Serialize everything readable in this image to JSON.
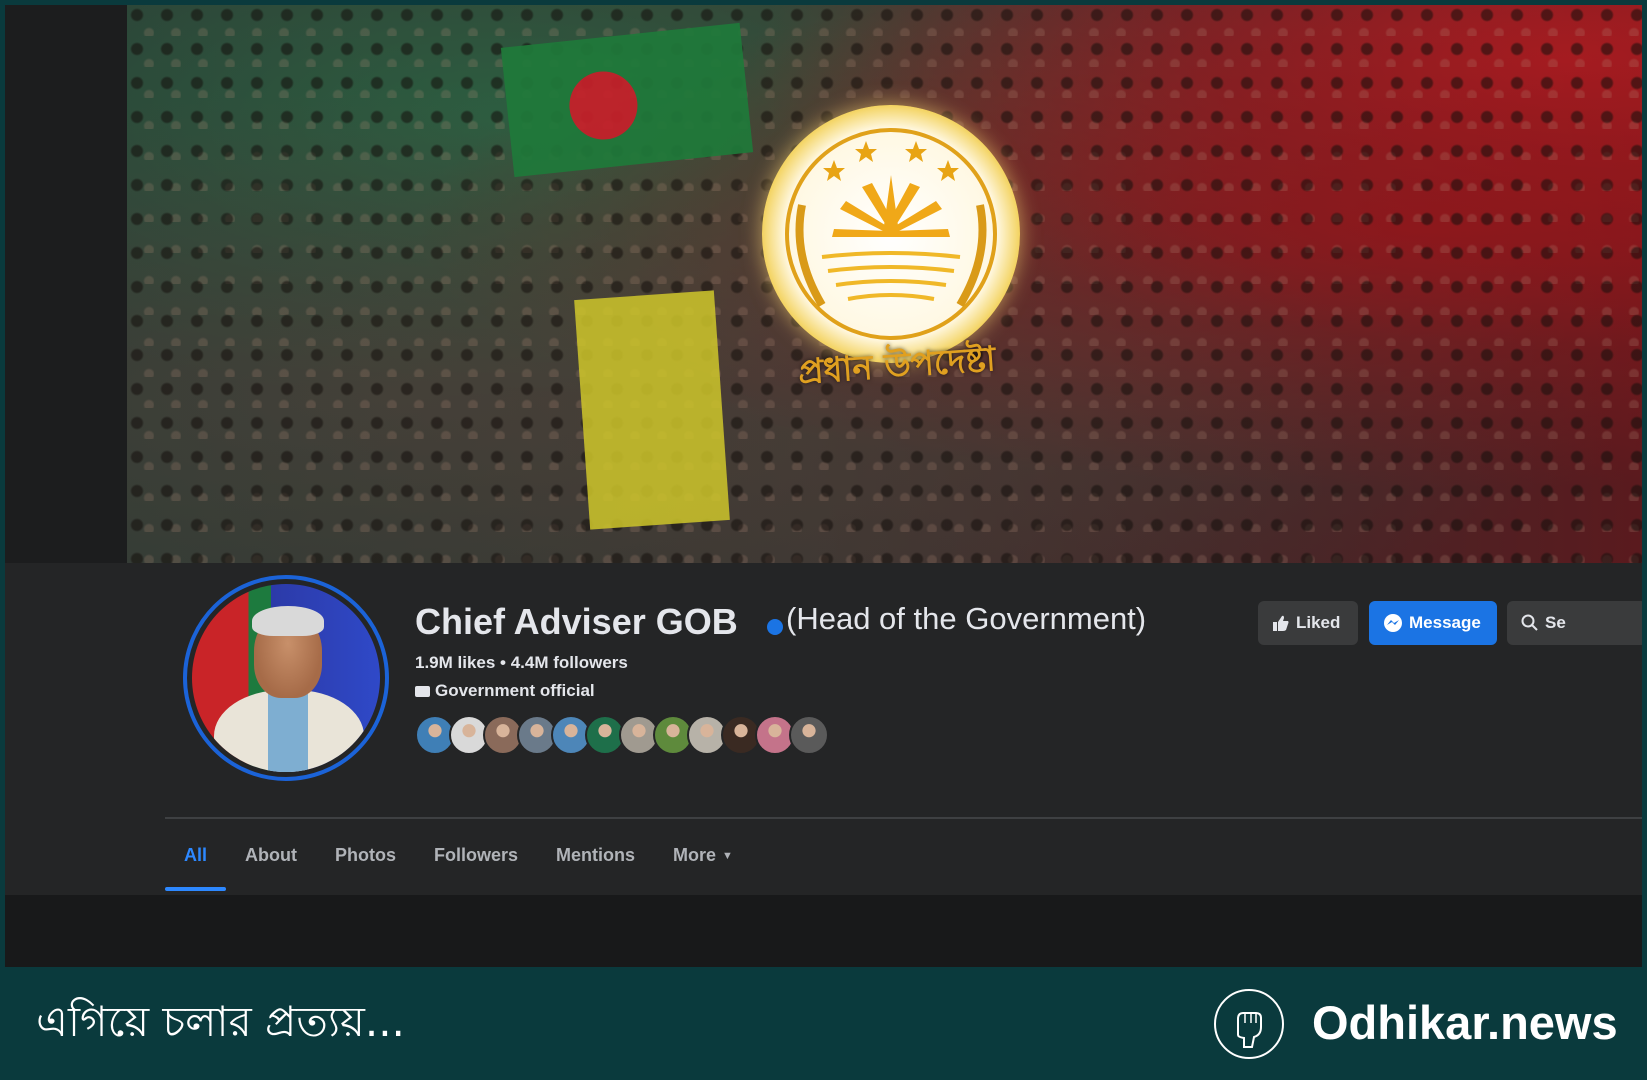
{
  "cover": {
    "emblem_caption": "প্রধান উপদেষ্টা"
  },
  "profile": {
    "name": "Chief Adviser GOB",
    "subtitle": "(Head of the Government)",
    "stats": "1.9M likes • 4.4M followers",
    "category": "Government official",
    "friend_avatar_colors": [
      "#3f7fb6",
      "#d9d9d9",
      "#8a6a5a",
      "#6a7a8a",
      "#4d86b8",
      "#1e6f4a",
      "#a09a90",
      "#5e8a3c",
      "#b7b2a8",
      "#3a2a22",
      "#c4738a",
      "#5a5a5a"
    ]
  },
  "actions": {
    "liked_label": "Liked",
    "message_label": "Message",
    "search_label": "Se"
  },
  "tabs": [
    {
      "label": "All"
    },
    {
      "label": "About"
    },
    {
      "label": "Photos"
    },
    {
      "label": "Followers"
    },
    {
      "label": "Mentions"
    },
    {
      "label": "More"
    }
  ],
  "footer": {
    "tagline": "এগিয়ে চলার প্রত্যয়...",
    "brand": "Odhikar.news"
  },
  "colors": {
    "accent": "#1b74e4",
    "banner": "#0a3a3d"
  }
}
